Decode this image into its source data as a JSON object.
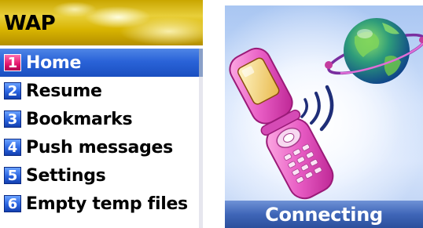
{
  "wap_screen": {
    "title": "WAP",
    "menu": [
      {
        "number": "1",
        "label": "Home",
        "selected": true
      },
      {
        "number": "2",
        "label": "Resume",
        "selected": false
      },
      {
        "number": "3",
        "label": "Bookmarks",
        "selected": false
      },
      {
        "number": "4",
        "label": "Push messages",
        "selected": false
      },
      {
        "number": "5",
        "label": "Settings",
        "selected": false
      },
      {
        "number": "6",
        "label": "Empty temp files",
        "selected": false
      }
    ]
  },
  "connect_screen": {
    "status": "Connecting",
    "illustration": [
      "flip-phone-icon",
      "signal-waves-icon",
      "globe-icon"
    ]
  },
  "colors": {
    "selection": "#2a63d8",
    "number_badge": "#2a64e0",
    "selected_badge": "#e4146b",
    "header_gold": "#d8b400",
    "status_bar": "#3f66b8"
  }
}
